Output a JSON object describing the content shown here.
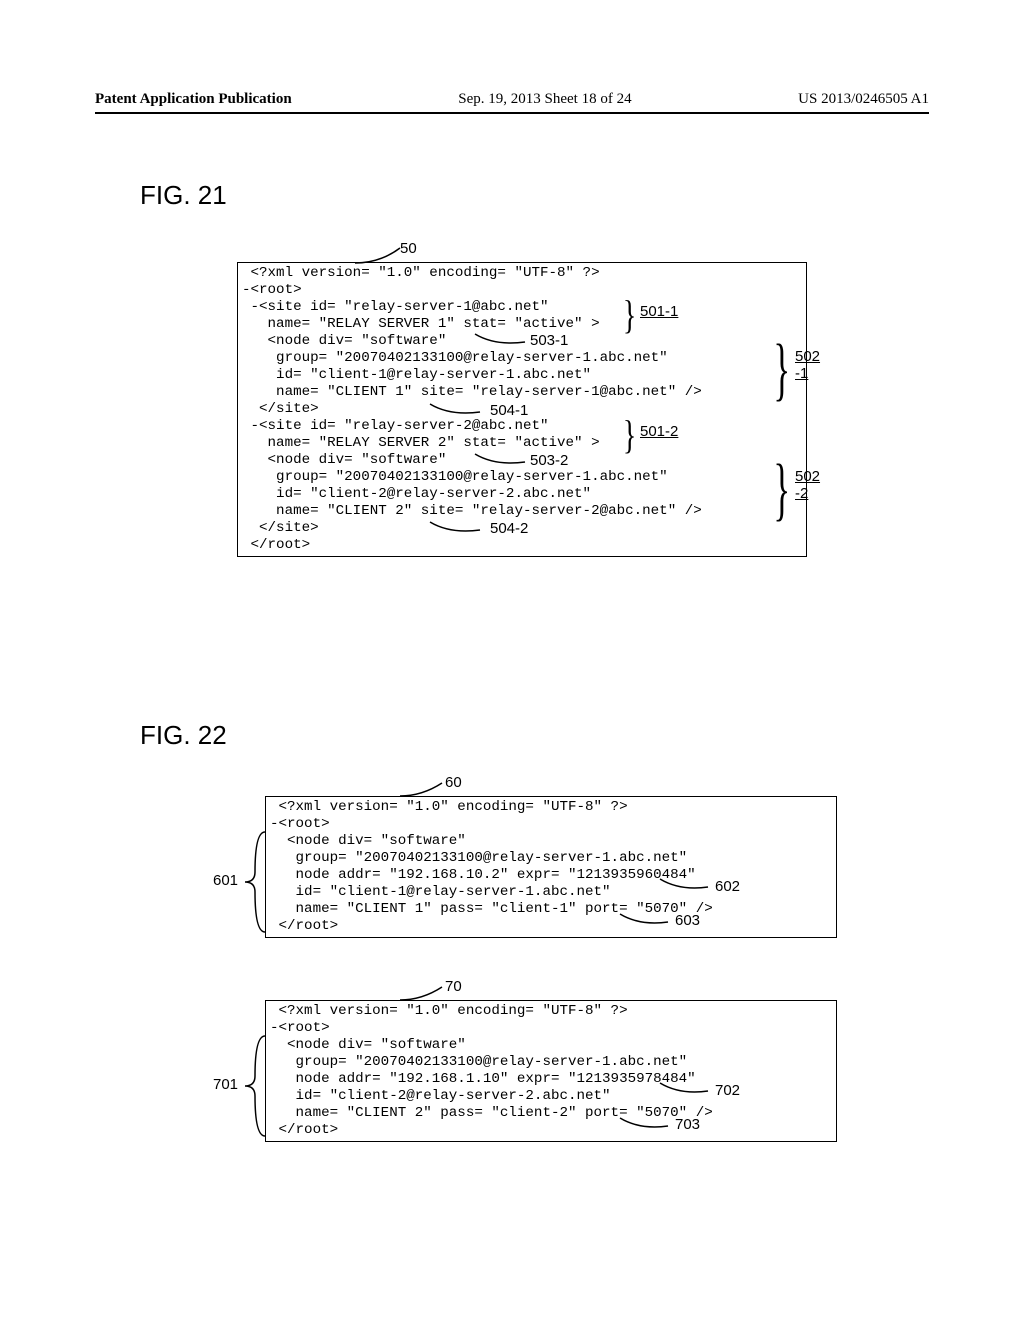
{
  "header": {
    "left": "Patent Application Publication",
    "center": "Sep. 19, 2013  Sheet 18 of 24",
    "right": "US 2013/0246505 A1"
  },
  "fig21": {
    "label": "FIG. 21",
    "ref50": "50",
    "code": " <?xml version= \"1.0\" encoding= \"UTF-8\" ?>\n-<root>\n -<site id= \"relay-server-1@abc.net\"\n   name= \"RELAY SERVER 1\" stat= \"active\" >\n   <node div= \"software\"\n    group= \"20070402133100@relay-server-1.abc.net\"\n    id= \"client-1@relay-server-1.abc.net\"\n    name= \"CLIENT 1\" site= \"relay-server-1@abc.net\" />\n  </site>\n -<site id= \"relay-server-2@abc.net\"\n   name= \"RELAY SERVER 2\" stat= \"active\" >\n   <node div= \"software\"\n    group= \"20070402133100@relay-server-1.abc.net\"\n    id= \"client-2@relay-server-2.abc.net\"\n    name= \"CLIENT 2\" site= \"relay-server-2@abc.net\" />\n  </site>\n </root>",
    "ref501_1": "501-1",
    "ref503_1": "503-1",
    "ref502_1a": "502",
    "ref502_1b": "-1",
    "ref504_1": "504-1",
    "ref501_2": "501-2",
    "ref503_2": "503-2",
    "ref502_2a": "502",
    "ref502_2b": "-2",
    "ref504_2": "504-2"
  },
  "fig22": {
    "label": "FIG. 22",
    "ref60": "60",
    "code60": " <?xml version= \"1.0\" encoding= \"UTF-8\" ?>\n-<root>\n  <node div= \"software\"\n   group= \"20070402133100@relay-server-1.abc.net\"\n   node addr= \"192.168.10.2\" expr= \"1213935960484\"\n   id= \"client-1@relay-server-1.abc.net\"\n   name= \"CLIENT 1\" pass= \"client-1\" port= \"5070\" />\n </root>",
    "ref601": "601",
    "ref602": "602",
    "ref603": "603",
    "ref70": "70",
    "code70": " <?xml version= \"1.0\" encoding= \"UTF-8\" ?>\n-<root>\n  <node div= \"software\"\n   group= \"20070402133100@relay-server-1.abc.net\"\n   node addr= \"192.168.1.10\" expr= \"1213935978484\"\n   id= \"client-2@relay-server-2.abc.net\"\n   name= \"CLIENT 2\" pass= \"client-2\" port= \"5070\" />\n </root>",
    "ref701": "701",
    "ref702": "702",
    "ref703": "703"
  }
}
